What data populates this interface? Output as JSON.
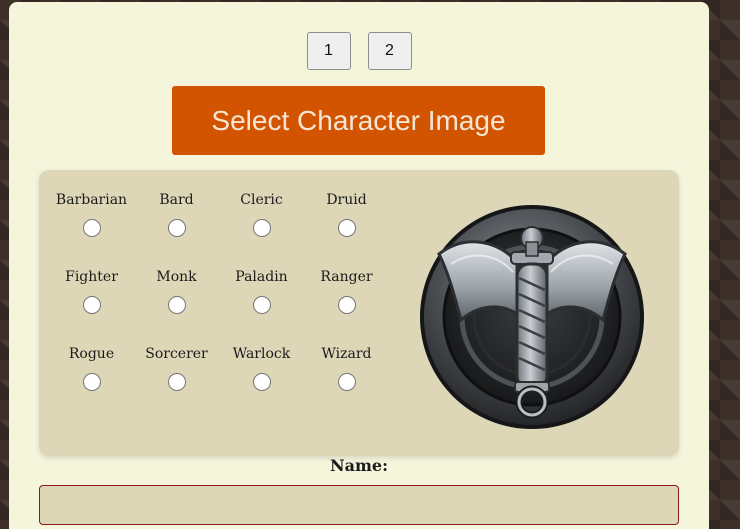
{
  "pagination": {
    "pages": [
      "1",
      "2"
    ]
  },
  "select_button": {
    "label": "Select Character Image"
  },
  "classes": [
    {
      "label": "Barbarian",
      "selected": false
    },
    {
      "label": "Bard",
      "selected": false
    },
    {
      "label": "Cleric",
      "selected": false
    },
    {
      "label": "Druid",
      "selected": false
    },
    {
      "label": "Fighter",
      "selected": false
    },
    {
      "label": "Monk",
      "selected": false
    },
    {
      "label": "Paladin",
      "selected": false
    },
    {
      "label": "Ranger",
      "selected": false
    },
    {
      "label": "Rogue",
      "selected": false
    },
    {
      "label": "Sorcerer",
      "selected": false
    },
    {
      "label": "Warlock",
      "selected": false
    },
    {
      "label": "Wizard",
      "selected": false
    }
  ],
  "emblem": {
    "icon": "dagger-emblem-icon"
  },
  "name_field": {
    "label": "Name:",
    "value": ""
  },
  "colors": {
    "accent": "#d35400",
    "panel": "#f5f5dc",
    "class_box": "#ddd6b7",
    "input_border": "#8b1a1a"
  }
}
